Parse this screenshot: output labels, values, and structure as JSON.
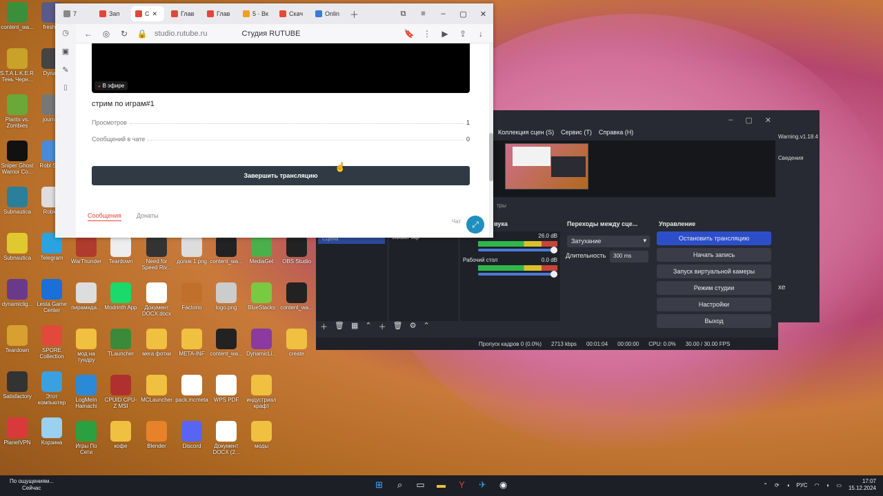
{
  "desktop": {
    "icons": [
      {
        "label": "content_wa...",
        "color": "#3b8f3b"
      },
      {
        "label": "freshar",
        "color": "#5a5a8a"
      },
      {
        "label": "S.T.A.L.K.E.R. Тень Черн...",
        "color": "#c9a22a"
      },
      {
        "label": "Dynam",
        "color": "#444"
      },
      {
        "label": "Plants vs. Zombies",
        "color": "#6aa83a"
      },
      {
        "label": "journey",
        "color": "#777"
      },
      {
        "label": "Sniper Ghost Warrior Co...",
        "color": "#111"
      },
      {
        "label": "Robl Stud",
        "color": "#4a8ad8"
      },
      {
        "label": "Subnautica",
        "color": "#2a7f9a"
      },
      {
        "label": "Roblox",
        "color": "#ddd"
      },
      {
        "label": "Subnautica",
        "color": "#e0c830"
      },
      {
        "label": "Telegram",
        "color": "#2aa3e0"
      },
      {
        "label": "WarThunder",
        "color": "#b03a2e"
      },
      {
        "label": "Teardown",
        "color": "#eee"
      },
      {
        "label": "Need for Speed Riv...",
        "color": "#333"
      },
      {
        "label": "долик 1.png",
        "color": "#ddd"
      },
      {
        "label": "content_wa...",
        "color": "#222"
      },
      {
        "label": "MediaGet",
        "color": "#4ab04a"
      },
      {
        "label": "OBS Studio",
        "color": "#222"
      },
      {
        "label": "dynamiclig...",
        "color": "#6a3a8a"
      },
      {
        "label": "Lesta Game Center",
        "color": "#1a6fd8"
      },
      {
        "label": "пирамида...",
        "color": "#ddd"
      },
      {
        "label": "Modrinth App",
        "color": "#1bd96a"
      },
      {
        "label": "Документ DOCX.docx",
        "color": "#fff"
      },
      {
        "label": "Factorio",
        "color": "#c0702a"
      },
      {
        "label": "logo.png",
        "color": "#ccc"
      },
      {
        "label": "BlueStacks",
        "color": "#7ac943"
      },
      {
        "label": "content_wa...",
        "color": "#222"
      },
      {
        "label": "Teardown",
        "color": "#d8a030"
      },
      {
        "label": "SPORE Collection",
        "color": "#e04a3a"
      },
      {
        "label": "мод на тундру",
        "color": "#f0c040"
      },
      {
        "label": "TLauncher",
        "color": "#3a8a3a"
      },
      {
        "label": "мега фотки",
        "color": "#f0c040"
      },
      {
        "label": "META-INF",
        "color": "#f0c040"
      },
      {
        "label": "content_wa...",
        "color": "#222"
      },
      {
        "label": "DynamicLi...",
        "color": "#8a3aa0"
      },
      {
        "label": "create",
        "color": "#f0c040"
      },
      {
        "label": "Satisfactory",
        "color": "#333"
      },
      {
        "label": "Этот компьютер",
        "color": "#3aa0e0"
      },
      {
        "label": "LogMeIn Hamachi",
        "color": "#2a8ad8"
      },
      {
        "label": "CPUID CPU-Z MSI",
        "color": "#b03030"
      },
      {
        "label": "MCLauncher",
        "color": "#f0c040"
      },
      {
        "label": "pack.mcmeta",
        "color": "#fff"
      },
      {
        "label": "WPS PDF",
        "color": "#fff"
      },
      {
        "label": "индустриал крафт",
        "color": "#f0c040"
      },
      {
        "label": "PlanetVPN",
        "color": "#d83a3a"
      },
      {
        "label": "Корзина",
        "color": "#9ad0f0"
      },
      {
        "label": "Игры По Сети",
        "color": "#2aa040"
      },
      {
        "label": "кофе",
        "color": "#f0c040"
      },
      {
        "label": "Blender",
        "color": "#e8822a"
      },
      {
        "label": "Discord",
        "color": "#5865f2"
      },
      {
        "label": "Документ DOCX (2...",
        "color": "#fff"
      },
      {
        "label": "моды",
        "color": "#f0c040"
      }
    ]
  },
  "browser": {
    "tabs": [
      {
        "label": "7",
        "color": "#888"
      },
      {
        "label": "Зап",
        "color": "#e0463b"
      },
      {
        "label": "С",
        "color": "#e0463b",
        "active": true
      },
      {
        "label": "Глав",
        "color": "#e0463b"
      },
      {
        "label": "Глав",
        "color": "#e0463b"
      },
      {
        "label": "5 · Вк",
        "color": "#f0a020"
      },
      {
        "label": "Скач",
        "color": "#e04a3a"
      },
      {
        "label": "Onlin",
        "color": "#3a7ad8"
      }
    ],
    "url": "studio.rutube.ru",
    "page_title": "Студия RUTUBE",
    "live_badge": "В эфире",
    "stream_title": "стрим по играм#1",
    "stats": [
      {
        "label": "Просмотров",
        "value": "1"
      },
      {
        "label": "Сообщений в чате",
        "value": "0"
      }
    ],
    "end_button": "Завершить трансляцию",
    "chat_tabs": [
      "Сообщения",
      "Донаты"
    ],
    "chat_label": "Чат"
  },
  "obs": {
    "menu": [
      "Коллекция сцен (S)",
      "Сервис (T)",
      "Справка (H)"
    ],
    "menu_partial": "P)",
    "docks": {
      "scenes_item": "Сцена",
      "sources_item": "Захват экр",
      "mixer_title": "вука",
      "transitions_title": "Переходы между сце...",
      "controls_title": "Управление",
      "filters_partial": "тры"
    },
    "mixer": [
      {
        "name": "",
        "db": "26.0 dB",
        "level": 0.72
      },
      {
        "name": "Рабочий стол",
        "db": "0.0 dB",
        "level": 0.84
      }
    ],
    "meter_scale": "-60-55-50-45-40-35-30-25-20-15-10 -5 0",
    "transition": "Затухание",
    "duration_label": "Длительность",
    "duration_value": "300 ms",
    "controls": [
      "Остановить трансляцию",
      "Начать запись",
      "Запуск виртуальной камеры",
      "Режим студии",
      "Настройки",
      "Выход"
    ],
    "status": {
      "dropped": "Пропуск кадров 0 (0.0%)",
      "bitrate": "2713 kbps",
      "live_time": "00:01:04",
      "rec_time": "00:00:00",
      "cpu": "CPU: 0.0%",
      "fps": "30.00 / 30.00 FPS"
    }
  },
  "side_window": {
    "title": "Warning.v1.18.4",
    "item": "Сведения",
    "partial": "xe"
  },
  "taskbar": {
    "notification_title": "По ощущениям...",
    "notification_time": "Сейчас",
    "lang": "РУС",
    "time": "17:07",
    "date": "15.12.2024"
  }
}
